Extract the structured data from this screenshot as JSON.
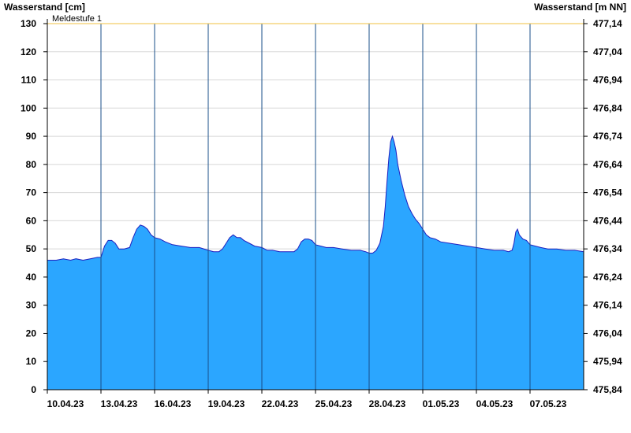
{
  "chart_data": {
    "type": "area",
    "ylabel_left": "Wasserstand [cm]",
    "ylabel_right": "Wasserstand [m NN]",
    "threshold": {
      "label": "Meldestufe 1",
      "value": 130,
      "color": "#f0c040"
    },
    "ylim": [
      0,
      130
    ],
    "yticks": [
      0,
      10,
      20,
      30,
      40,
      50,
      60,
      70,
      80,
      90,
      100,
      110,
      120,
      130
    ],
    "yticks_right": [
      "475,84",
      "475,94",
      "476,04",
      "476,14",
      "476,24",
      "476,34",
      "476,44",
      "476,54",
      "476,64",
      "476,74",
      "476,84",
      "476,94",
      "477,04",
      "477,14"
    ],
    "xlim_days": [
      0,
      30
    ],
    "xtick_labels": [
      "10.04.23",
      "13.04.23",
      "16.04.23",
      "19.04.23",
      "22.04.23",
      "25.04.23",
      "28.04.23",
      "01.05.23",
      "04.05.23",
      "07.05.23"
    ],
    "xtick_days": [
      0,
      3,
      6,
      9,
      12,
      15,
      18,
      21,
      24,
      27
    ],
    "fill_color": "#2ba6ff",
    "line_color": "#1f1fbf",
    "grid": true,
    "series": [
      {
        "name": "",
        "points": [
          [
            0.0,
            46
          ],
          [
            0.5,
            46
          ],
          [
            0.9,
            46.5
          ],
          [
            1.3,
            46
          ],
          [
            1.6,
            46.5
          ],
          [
            2.0,
            46
          ],
          [
            2.4,
            46.5
          ],
          [
            2.8,
            47
          ],
          [
            3.0,
            47
          ],
          [
            3.2,
            51
          ],
          [
            3.4,
            53
          ],
          [
            3.6,
            53
          ],
          [
            3.8,
            52
          ],
          [
            4.0,
            50
          ],
          [
            4.3,
            50
          ],
          [
            4.6,
            50.5
          ],
          [
            4.8,
            54
          ],
          [
            5.0,
            57
          ],
          [
            5.2,
            58.5
          ],
          [
            5.4,
            58
          ],
          [
            5.6,
            57
          ],
          [
            5.8,
            55
          ],
          [
            6.0,
            54
          ],
          [
            6.3,
            53.5
          ],
          [
            6.6,
            52.5
          ],
          [
            7.0,
            51.5
          ],
          [
            7.5,
            51
          ],
          [
            8.0,
            50.5
          ],
          [
            8.5,
            50.5
          ],
          [
            9.0,
            49.5
          ],
          [
            9.3,
            49
          ],
          [
            9.6,
            49
          ],
          [
            9.8,
            50
          ],
          [
            10.0,
            52
          ],
          [
            10.2,
            54
          ],
          [
            10.4,
            55
          ],
          [
            10.6,
            54
          ],
          [
            10.8,
            54
          ],
          [
            11.0,
            53
          ],
          [
            11.3,
            52
          ],
          [
            11.6,
            51
          ],
          [
            12.0,
            50.5
          ],
          [
            12.3,
            49.5
          ],
          [
            12.6,
            49.5
          ],
          [
            13.0,
            49
          ],
          [
            13.5,
            49
          ],
          [
            13.8,
            49
          ],
          [
            14.0,
            50
          ],
          [
            14.2,
            52.5
          ],
          [
            14.4,
            53.5
          ],
          [
            14.6,
            53.5
          ],
          [
            14.8,
            53
          ],
          [
            15.0,
            51.5
          ],
          [
            15.3,
            51
          ],
          [
            15.6,
            50.5
          ],
          [
            16.0,
            50.5
          ],
          [
            16.5,
            50
          ],
          [
            17.0,
            49.5
          ],
          [
            17.5,
            49.5
          ],
          [
            17.8,
            49
          ],
          [
            18.0,
            48.5
          ],
          [
            18.2,
            48.5
          ],
          [
            18.4,
            49.5
          ],
          [
            18.6,
            52
          ],
          [
            18.8,
            58
          ],
          [
            18.9,
            65
          ],
          [
            19.0,
            74
          ],
          [
            19.1,
            82
          ],
          [
            19.2,
            88
          ],
          [
            19.3,
            90
          ],
          [
            19.4,
            88
          ],
          [
            19.5,
            85
          ],
          [
            19.6,
            80
          ],
          [
            19.8,
            74
          ],
          [
            20.0,
            69
          ],
          [
            20.2,
            65
          ],
          [
            20.4,
            62.5
          ],
          [
            20.6,
            60.5
          ],
          [
            20.8,
            59
          ],
          [
            21.0,
            57
          ],
          [
            21.2,
            55
          ],
          [
            21.4,
            54
          ],
          [
            21.7,
            53.5
          ],
          [
            22.0,
            52.5
          ],
          [
            22.5,
            52
          ],
          [
            23.0,
            51.5
          ],
          [
            23.5,
            51
          ],
          [
            24.0,
            50.5
          ],
          [
            24.5,
            50
          ],
          [
            25.0,
            49.5
          ],
          [
            25.5,
            49.5
          ],
          [
            25.8,
            49
          ],
          [
            26.0,
            49.5
          ],
          [
            26.1,
            52
          ],
          [
            26.2,
            56
          ],
          [
            26.3,
            57
          ],
          [
            26.4,
            55
          ],
          [
            26.6,
            53.5
          ],
          [
            26.8,
            53
          ],
          [
            27.0,
            51.5
          ],
          [
            27.3,
            51
          ],
          [
            27.6,
            50.5
          ],
          [
            28.0,
            50
          ],
          [
            28.5,
            50
          ],
          [
            29.0,
            49.5
          ],
          [
            29.5,
            49.5
          ],
          [
            30.0,
            49
          ]
        ]
      }
    ]
  }
}
